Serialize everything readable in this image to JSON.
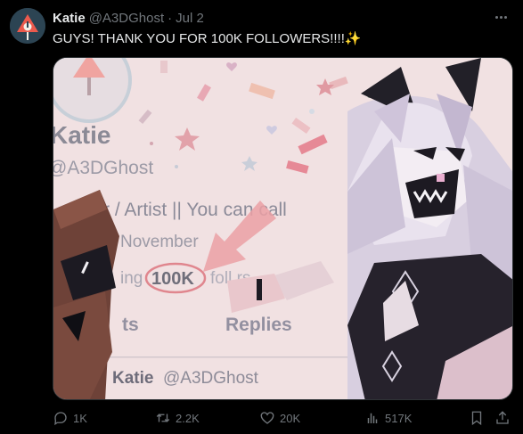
{
  "tweet": {
    "author_name": "Katie",
    "author_handle": "@A3DGhost",
    "separator": "·",
    "date": "Jul 2",
    "text": "GUYS! THANK YOU FOR 100K FOLLOWERS!!!!",
    "text_emoji": "✨"
  },
  "media": {
    "profile_name": "Katie",
    "profile_handle": "@A3DGhost",
    "bio_line": "r / Artist || You can call",
    "joined": "November",
    "following_prefix": "ing",
    "follower_count": "100K",
    "followers_suffix": "foll   rs",
    "tab_posts": "ts",
    "tab_replies": "Replies",
    "bottom_name": "Katie",
    "bottom_handle": "@A3DGhost"
  },
  "actions": {
    "replies": "1K",
    "reposts": "2.2K",
    "likes": "20K",
    "views": "517K"
  },
  "colors": {
    "background": "#000000",
    "text_primary": "#e7e9ea",
    "text_secondary": "#71767b",
    "media_bg": "#f1e1e2"
  }
}
